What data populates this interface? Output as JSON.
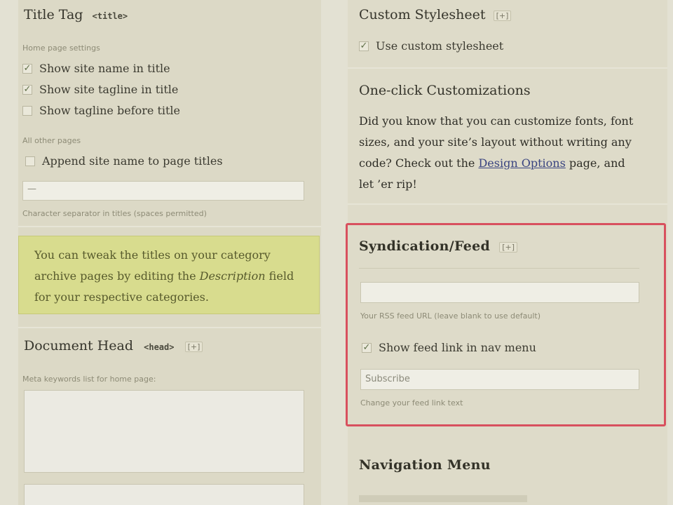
{
  "left": {
    "title_tag": {
      "heading": "Title Tag",
      "tag": "<title>",
      "home_label": "Home page settings",
      "options": [
        {
          "label": "Show site name in title",
          "checked": true
        },
        {
          "label": "Show site tagline in title",
          "checked": true
        },
        {
          "label": "Show tagline before title",
          "checked": false
        }
      ],
      "other_label": "All other pages",
      "append_option": {
        "label": "Append site name to page titles",
        "checked": false
      },
      "separator_value": "—",
      "separator_hint": "Character separator in titles (spaces permitted)"
    },
    "notice": {
      "text_before": "You can tweak the titles on your category archive pages by editing the ",
      "text_em": "Description",
      "text_after": " field for your respective categories."
    },
    "document_head": {
      "heading": "Document Head",
      "tag": "<head>",
      "toggle": "[+]",
      "hint": "Meta keywords list for home page:"
    }
  },
  "right": {
    "custom_stylesheet": {
      "heading": "Custom Stylesheet",
      "toggle": "[+]",
      "option": {
        "label": "Use custom stylesheet",
        "checked": true
      }
    },
    "one_click": {
      "heading": "One-click Customizations",
      "text_before": "Did you know that you can customize fonts, font sizes, and your site’s layout without writing any code? Check out the ",
      "link": "Design Options",
      "text_after": " page, and let ’er rip!"
    },
    "syndication": {
      "heading": "Syndication/Feed",
      "toggle": "[+]",
      "feed_url_value": "",
      "feed_url_hint": "Your RSS feed URL (leave blank to use default)",
      "option": {
        "label": "Show feed link in nav menu",
        "checked": true
      },
      "link_text_value": "Subscribe",
      "link_text_hint": "Change your feed link text"
    },
    "navigation": {
      "heading": "Navigation Menu"
    }
  },
  "colors": {
    "highlight_border": "#d8505e",
    "notice_bg": "#d8dc8e",
    "link": "#3a4480"
  }
}
